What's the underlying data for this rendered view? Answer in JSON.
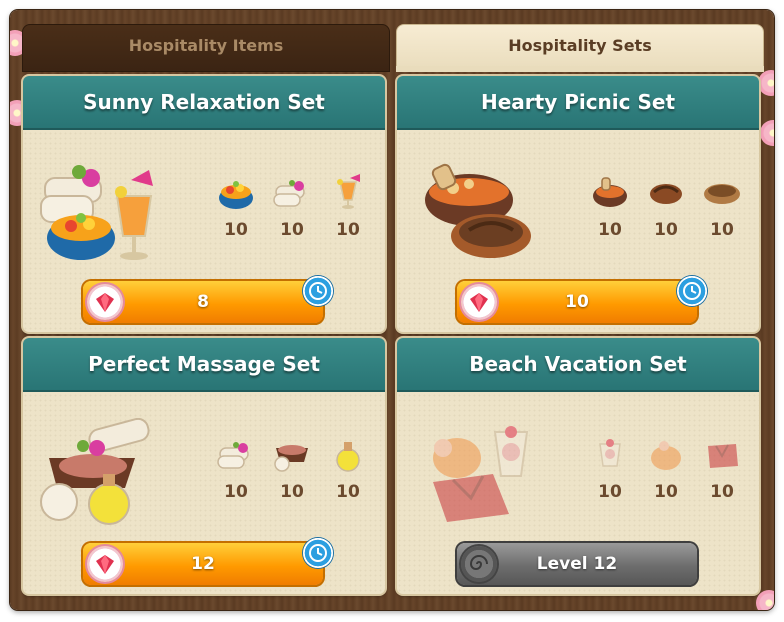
{
  "tabs": [
    {
      "label": "Hospitality Items",
      "active": false
    },
    {
      "label": "Hospitality Sets",
      "active": true
    }
  ],
  "sets": [
    {
      "title": "Sunny Relaxation Set",
      "items": [
        {
          "icon": "fruit-bowl-icon",
          "qty": "10"
        },
        {
          "icon": "towel-icon",
          "qty": "10"
        },
        {
          "icon": "cocktail-icon",
          "qty": "10"
        }
      ],
      "button": {
        "label": "8",
        "type": "gem-price",
        "timer": true
      }
    },
    {
      "title": "Hearty Picnic Set",
      "items": [
        {
          "icon": "soup-pot-icon",
          "qty": "10"
        },
        {
          "icon": "bread-loaf-icon",
          "qty": "10"
        },
        {
          "icon": "basket-icon",
          "qty": "10"
        }
      ],
      "button": {
        "label": "10",
        "type": "gem-price",
        "timer": true
      }
    },
    {
      "title": "Perfect Massage Set",
      "items": [
        {
          "icon": "towel-icon",
          "qty": "10"
        },
        {
          "icon": "massage-basket-icon",
          "qty": "10"
        },
        {
          "icon": "oil-bottle-icon",
          "qty": "10"
        }
      ],
      "button": {
        "label": "12",
        "type": "gem-price",
        "timer": true
      }
    },
    {
      "title": "Beach Vacation Set",
      "items": [
        {
          "icon": "parfait-icon",
          "qty": "10"
        },
        {
          "icon": "pumpkin-cake-icon",
          "qty": "10"
        },
        {
          "icon": "robe-icon",
          "qty": "10"
        }
      ],
      "button": {
        "label": "Level 12",
        "type": "locked",
        "timer": false
      }
    }
  ],
  "colors": {
    "header_teal": "#297575",
    "card_bg": "#ede3c8",
    "button_orange": "#ff9a00",
    "button_locked": "#6d6d6d",
    "qty_text": "#6b4a2e"
  }
}
